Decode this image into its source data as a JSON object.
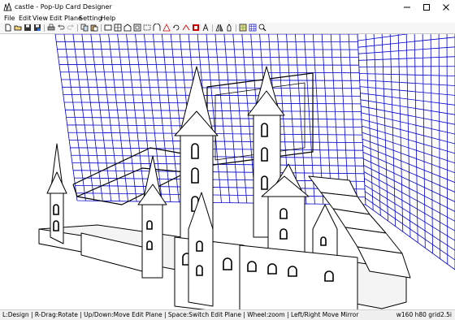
{
  "window": {
    "title": "castle - Pop-Up Card Designer"
  },
  "menu": {
    "items": [
      {
        "label": "File"
      },
      {
        "label": "Edit"
      },
      {
        "label": "View"
      },
      {
        "label": "Edit Plane"
      },
      {
        "label": "Setting"
      },
      {
        "label": "Help"
      }
    ]
  },
  "toolbar": {
    "icons": [
      "new-icon",
      "open-icon",
      "save-icon",
      "save-as-icon",
      "print-icon",
      "undo-icon",
      "redo-icon",
      "copy-icon",
      "paste-icon",
      "rect-icon",
      "house-icon",
      "window-icon",
      "arch-icon",
      "triangle-icon",
      "rotate-icon",
      "fold-icon",
      "flag-icon",
      "cut-icon",
      "mirror-icon",
      "tower-icon",
      "pattern-icon",
      "grid-icon",
      "zoom-icon"
    ]
  },
  "status": {
    "left": "L:Design | R-Drag:Rotate | Up/Down:Move Edit Plane | Space:Switch Edit Plane | Wheel:zoom | Left/Right Move Mirror",
    "right": "w160 h80 grid2.5i"
  },
  "colors": {
    "grid": "#0000cc",
    "grid_bg": "#ffffff",
    "model": "#ffffff",
    "outline": "#000000",
    "shadow": "#bbbbbb"
  }
}
